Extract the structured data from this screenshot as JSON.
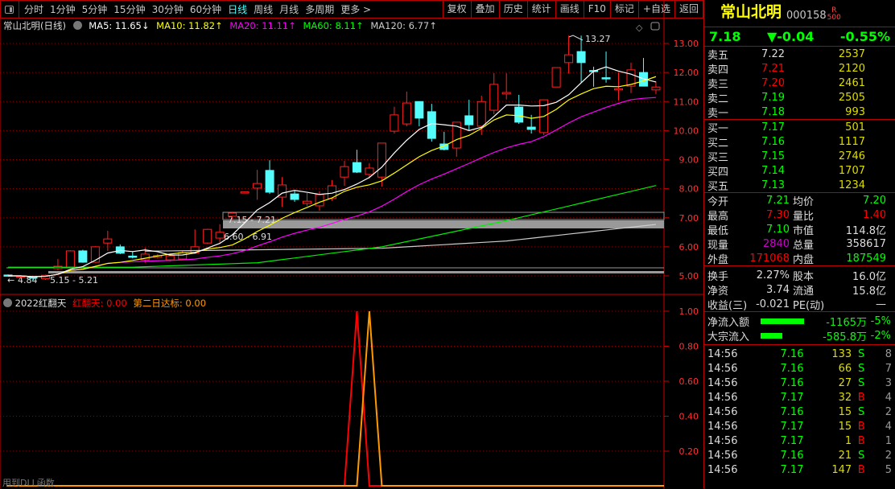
{
  "toolbar": {
    "periods": [
      "分时",
      "1分钟",
      "5分钟",
      "15分钟",
      "30分钟",
      "60分钟",
      "日线",
      "周线",
      "月线",
      "多周期",
      "更多 >"
    ],
    "active_period": "日线",
    "buttons": [
      "复权",
      "叠加",
      "历史",
      "统计",
      "画线",
      "F10",
      "标记",
      "+自选",
      "返回"
    ]
  },
  "legend": {
    "title": "常山北明(日线)",
    "ma5": "MA5: 11.65↓",
    "ma10": "MA10: 11.82↑",
    "ma20": "MA20: 11.11↑",
    "ma60": "MA60: 8.11↑",
    "ma120": "MA120: 6.77↑"
  },
  "colors": {
    "up": "#ff2020",
    "down": "#54fcfc",
    "ma5": "#ffffff",
    "ma10": "#ffff00",
    "ma20": "#ff00ff",
    "ma60": "#00ee00",
    "ma120": "#cccccc",
    "axis": "#ff3030"
  },
  "chart_data": {
    "type": "candlestick",
    "yaxis_ticks": [
      "13.00",
      "12.00",
      "11.00",
      "10.00",
      "9.00",
      "8.00",
      "7.00",
      "6.00",
      "5.00"
    ],
    "ylim": [
      5.0,
      13.0
    ],
    "annotations": {
      "high": "13.27",
      "low": "4.84",
      "zone1": "7.15 - 7.21",
      "zone2": "6.60 - 6.91",
      "zone3": "5.15 - 5.21"
    },
    "ohlc": [
      [
        5.03,
        5.0,
        5.05,
        4.98
      ],
      [
        4.98,
        5.0,
        5.02,
        4.96
      ],
      [
        4.97,
        4.92,
        5.0,
        4.84
      ],
      [
        4.9,
        5.02,
        5.04,
        4.86
      ],
      [
        5.25,
        5.33,
        5.58,
        5.2
      ],
      [
        5.3,
        5.86,
        5.88,
        5.28
      ],
      [
        5.86,
        5.47,
        5.9,
        5.45
      ],
      [
        5.47,
        6.0,
        6.02,
        5.45
      ],
      [
        6.13,
        6.27,
        6.55,
        5.86
      ],
      [
        6.0,
        5.78,
        6.08,
        5.75
      ],
      [
        5.68,
        5.66,
        5.85,
        5.6
      ],
      [
        5.55,
        5.75,
        5.97,
        5.45
      ],
      [
        5.64,
        5.7,
        5.75,
        5.6
      ],
      [
        5.55,
        5.69,
        5.75,
        5.5
      ],
      [
        5.58,
        5.8,
        5.85,
        5.55
      ],
      [
        5.78,
        6.0,
        6.6,
        5.75
      ],
      [
        6.13,
        6.6,
        6.62,
        6.1
      ],
      [
        6.3,
        6.5,
        6.78,
        6.1
      ],
      [
        7.05,
        7.16,
        7.21,
        6.95
      ],
      [
        7.88,
        7.89,
        7.89,
        7.88
      ],
      [
        8.02,
        8.18,
        8.65,
        7.62
      ],
      [
        8.63,
        7.88,
        8.98,
        7.82
      ],
      [
        7.71,
        8.13,
        8.4,
        7.38
      ],
      [
        7.82,
        7.63,
        7.93,
        7.55
      ],
      [
        7.49,
        7.57,
        7.85,
        7.4
      ],
      [
        7.41,
        7.8,
        7.91,
        7.24
      ],
      [
        7.66,
        8.1,
        8.3,
        7.58
      ],
      [
        8.4,
        8.76,
        8.96,
        8.1
      ],
      [
        8.9,
        8.57,
        9.34,
        8.54
      ],
      [
        8.49,
        8.71,
        8.88,
        8.35
      ],
      [
        8.4,
        9.57,
        9.57,
        8.07
      ],
      [
        9.98,
        10.54,
        10.82,
        9.9
      ],
      [
        10.23,
        10.95,
        11.34,
        10.15
      ],
      [
        11.0,
        10.43,
        11.0,
        10.15
      ],
      [
        10.65,
        9.73,
        10.92,
        9.62
      ],
      [
        9.54,
        9.35,
        9.96,
        9.32
      ],
      [
        9.4,
        10.29,
        10.29,
        9.1
      ],
      [
        10.51,
        10.2,
        11.06,
        10.0
      ],
      [
        10.15,
        11.0,
        11.2,
        9.85
      ],
      [
        10.7,
        11.59,
        11.98,
        10.56
      ],
      [
        11.26,
        11.31,
        11.98,
        11.07
      ],
      [
        10.81,
        10.29,
        11.23,
        10.23
      ],
      [
        10.12,
        10.04,
        10.54,
        9.9
      ],
      [
        9.93,
        11.06,
        11.06,
        9.85
      ],
      [
        11.5,
        12.17,
        12.17,
        11.5
      ],
      [
        12.34,
        12.61,
        13.27,
        11.96
      ],
      [
        12.72,
        12.34,
        13.27,
        11.65
      ],
      [
        12.07,
        12.04,
        12.2,
        11.51
      ],
      [
        11.82,
        11.8,
        12.72,
        11.65
      ],
      [
        11.4,
        11.44,
        12.0,
        11.04
      ],
      [
        11.53,
        12.09,
        12.34,
        11.29
      ],
      [
        12.0,
        11.53,
        12.5,
        11.53
      ],
      [
        11.4,
        11.5,
        11.7,
        11.26
      ]
    ],
    "ma60_points": [
      [
        0,
        5.3
      ],
      [
        10,
        5.3
      ],
      [
        20,
        5.45
      ],
      [
        30,
        6.0
      ],
      [
        40,
        6.9
      ],
      [
        52,
        8.11
      ]
    ],
    "ma120_points": [
      [
        11,
        5.85
      ],
      [
        30,
        5.95
      ],
      [
        40,
        6.2
      ],
      [
        52,
        6.77
      ]
    ],
    "indicator": {
      "title": "2022红翻天",
      "s1": "红翻天: 0.00",
      "s2": "第二日达标: 0.00",
      "yaxis_ticks": [
        "1.00",
        "0.80",
        "0.60",
        "0.40",
        "0.20"
      ],
      "ylim": [
        0,
        1
      ],
      "red_spike_index": 28,
      "orange_spike_index": 29
    }
  },
  "footer_note": "用到DLL函数",
  "stock": {
    "name": "常山北明",
    "code": "000158",
    "badge_r": "R",
    "badge_num": "500",
    "price": "7.18",
    "change": "▼-0.04",
    "pct": "-0.55%"
  },
  "orderbook": {
    "asks": [
      {
        "l": "卖五",
        "p": "7.22",
        "v": "2537"
      },
      {
        "l": "卖四",
        "p": "7.21",
        "v": "2120"
      },
      {
        "l": "卖三",
        "p": "7.20",
        "v": "2461"
      },
      {
        "l": "卖二",
        "p": "7.19",
        "v": "2505"
      },
      {
        "l": "卖一",
        "p": "7.18",
        "v": "993"
      }
    ],
    "bids": [
      {
        "l": "买一",
        "p": "7.17",
        "v": "501"
      },
      {
        "l": "买二",
        "p": "7.16",
        "v": "1117"
      },
      {
        "l": "买三",
        "p": "7.15",
        "v": "2746"
      },
      {
        "l": "买四",
        "p": "7.14",
        "v": "1707"
      },
      {
        "l": "买五",
        "p": "7.13",
        "v": "1234"
      }
    ]
  },
  "stats1": [
    {
      "l1": "今开",
      "v1": "7.21",
      "l2": "均价",
      "v2": "7.20"
    },
    {
      "l1": "最高",
      "v1": "7.30",
      "l2": "量比",
      "v2": "1.40"
    },
    {
      "l1": "最低",
      "v1": "7.10",
      "l2": "市值",
      "v2": "114.8亿"
    },
    {
      "l1": "现量",
      "v1": "2840",
      "l2": "总量",
      "v2": "358617"
    },
    {
      "l1": "外盘",
      "v1": "171068",
      "l2": "内盘",
      "v2": "187549"
    }
  ],
  "stats2": [
    {
      "l1": "换手",
      "v1": "2.27%",
      "l2": "股本",
      "v2": "16.0亿"
    },
    {
      "l1": "净资",
      "v1": "3.74",
      "l2": "流通",
      "v2": "15.8亿"
    },
    {
      "l1": "收益(三)",
      "v1": "-0.021",
      "l2": "PE(动)",
      "v2": "—"
    }
  ],
  "flows": [
    {
      "l": "净流入额",
      "v": "-1165万",
      "p": "-5%",
      "bar": 1.0
    },
    {
      "l": "大宗流入",
      "v": "-585.8万",
      "p": "-2%",
      "bar": 0.5
    }
  ],
  "ticks": [
    {
      "t": "14:56",
      "p": "7.16",
      "q": "133",
      "bs": "S",
      "n": "8"
    },
    {
      "t": "14:56",
      "p": "7.16",
      "q": "66",
      "bs": "S",
      "n": "7"
    },
    {
      "t": "14:56",
      "p": "7.16",
      "q": "27",
      "bs": "S",
      "n": "3"
    },
    {
      "t": "14:56",
      "p": "7.17",
      "q": "32",
      "bs": "B",
      "n": "4"
    },
    {
      "t": "14:56",
      "p": "7.16",
      "q": "15",
      "bs": "S",
      "n": "2"
    },
    {
      "t": "14:56",
      "p": "7.17",
      "q": "15",
      "bs": "B",
      "n": "4"
    },
    {
      "t": "14:56",
      "p": "7.17",
      "q": "1",
      "bs": "B",
      "n": "1"
    },
    {
      "t": "14:56",
      "p": "7.16",
      "q": "21",
      "bs": "S",
      "n": "2"
    },
    {
      "t": "14:56",
      "p": "7.17",
      "q": "147",
      "bs": "B",
      "n": "5"
    }
  ]
}
